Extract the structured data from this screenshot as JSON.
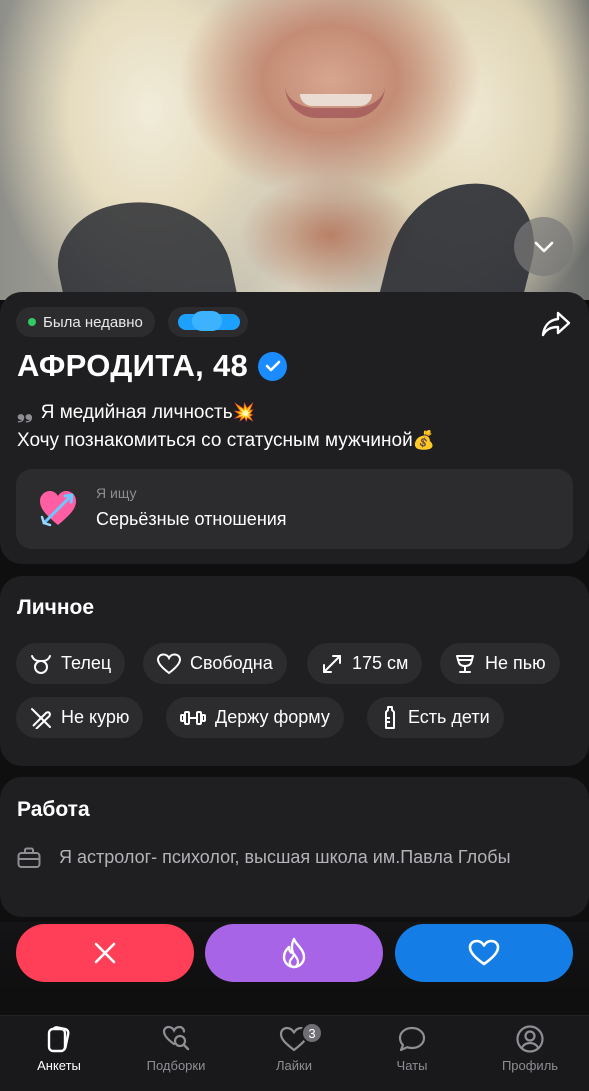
{
  "profile": {
    "status": "Была недавно",
    "name_age": "АФРОДИТА, 48",
    "bio_line1": "Я медийная личность",
    "bio_line1_emoji": "💥",
    "bio_line2": "Хочу познакомиться со статусным мужчиной",
    "bio_line2_emoji": "💰",
    "looking_label": "Я ищу",
    "looking_value": "Серьёзные отношения",
    "looking_icon": "heart-with-arrow-icon"
  },
  "personal": {
    "title": "Личное",
    "chips": [
      {
        "label": "Телец",
        "icon": "taurus-icon"
      },
      {
        "label": "Свободна",
        "icon": "heart-outline-icon"
      },
      {
        "label": "175 см",
        "icon": "height-arrows-icon"
      },
      {
        "label": "Не пью",
        "icon": "glass-icon"
      },
      {
        "label": "Не курю",
        "icon": "no-smoking-icon"
      },
      {
        "label": "Держу форму",
        "icon": "dumbbell-icon"
      },
      {
        "label": "Есть дети",
        "icon": "baby-bottle-icon"
      }
    ]
  },
  "work": {
    "title": "Работа",
    "text": "Я астролог- психолог, высшая школа им.Павла Глобы",
    "icon": "briefcase-icon"
  },
  "actions": {
    "dislike_icon": "close-icon",
    "super_icon": "flame-icon",
    "like_icon": "heart-icon"
  },
  "nav": {
    "items": [
      {
        "label": "Анкеты",
        "icon": "cards-icon",
        "active": true
      },
      {
        "label": "Подборки",
        "icon": "heart-search-icon",
        "active": false
      },
      {
        "label": "Лайки",
        "icon": "heart-outline-icon",
        "active": false,
        "badge": "3"
      },
      {
        "label": "Чаты",
        "icon": "chat-bubble-icon",
        "active": false
      },
      {
        "label": "Профиль",
        "icon": "user-circle-icon",
        "active": false
      }
    ]
  },
  "colors": {
    "background": "#0f0f10",
    "card": "#1f1f21",
    "chip": "#2c2c2e",
    "online_dot": "#32c964",
    "verified": "#1a8cff",
    "dislike": "#ff3e57",
    "super_like": "#a864e6",
    "like": "#157ee6"
  }
}
